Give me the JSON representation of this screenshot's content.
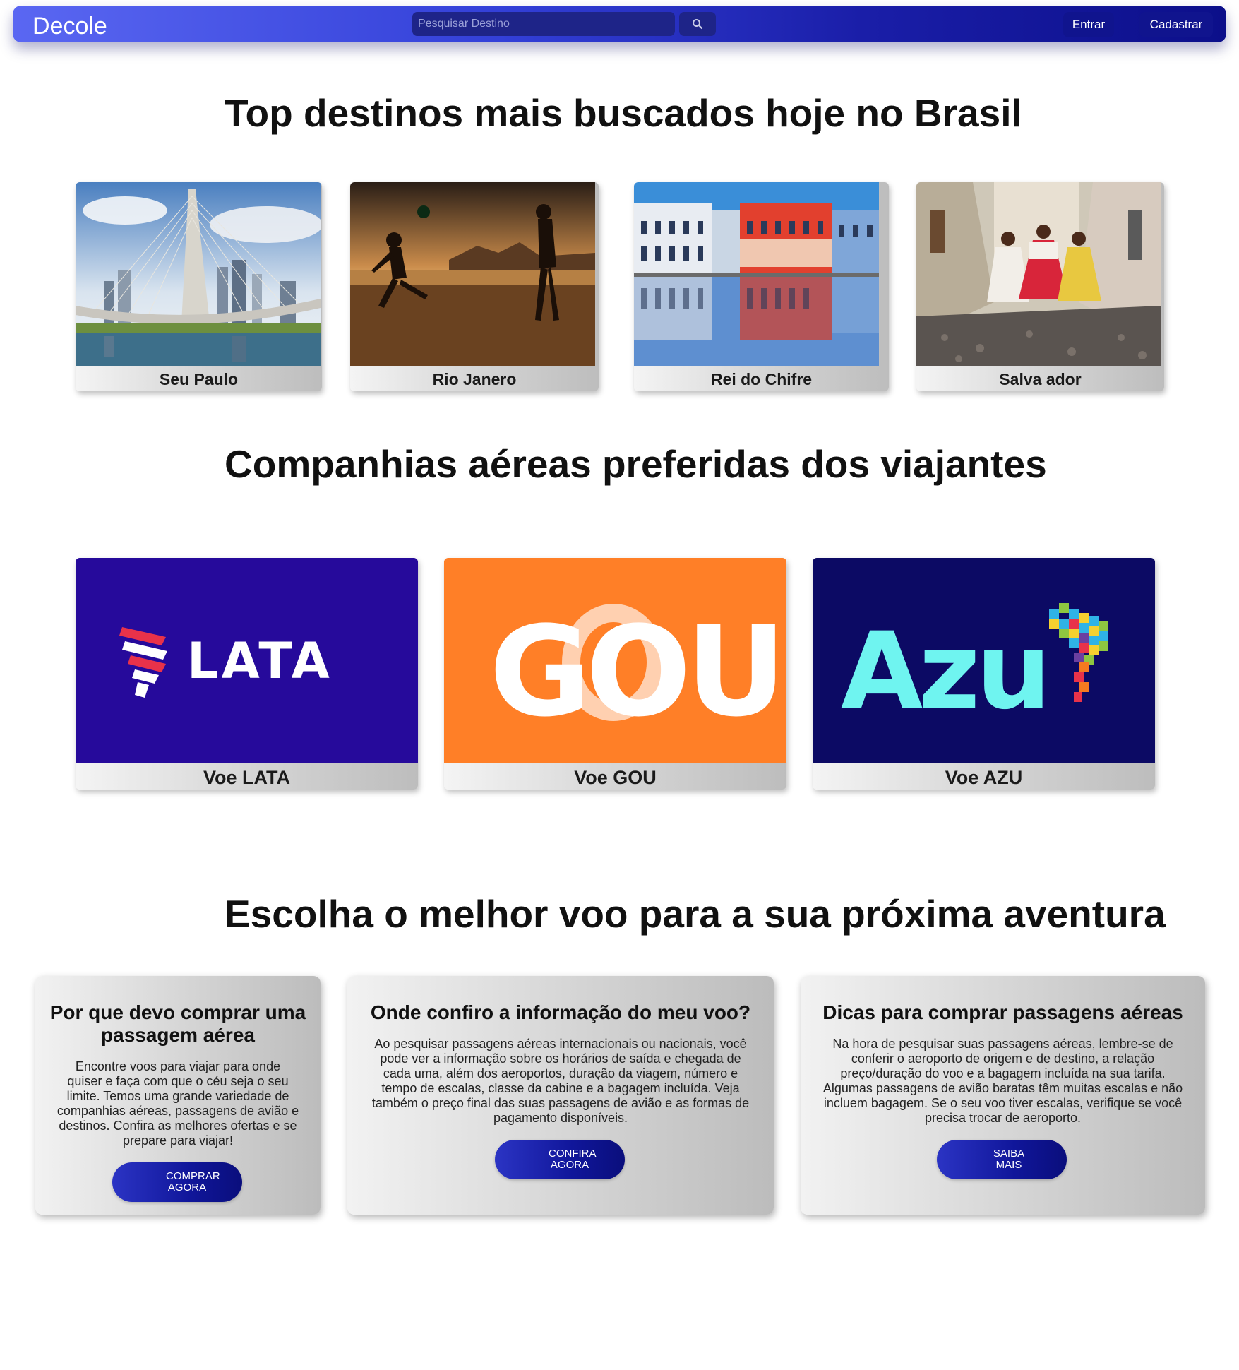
{
  "navbar": {
    "brand": "Decole",
    "search_placeholder": "Pesquisar Destino",
    "search_icon": "search-icon",
    "login_label": "Entrar",
    "signup_label": "Cadastrar"
  },
  "destinations": {
    "title": "Top destinos mais buscados hoje no Brasil",
    "items": [
      {
        "label": "Seu Paulo",
        "image": "cable-stayed-bridge-skyline"
      },
      {
        "label": "Rio Janero",
        "image": "beach-football-sunset"
      },
      {
        "label": "Rei do Chifre",
        "image": "colonial-buildings-reflection"
      },
      {
        "label": "Salva ador",
        "image": "cobblestone-street-baianas"
      }
    ]
  },
  "airlines": {
    "title": "Companhias aéreas preferidas dos viajantes",
    "items": [
      {
        "label": "Voe LATA",
        "logo_text": "LATA",
        "bg": "#260a9b",
        "fg": "#ffffff"
      },
      {
        "label": "Voe GOU",
        "logo_text": "GOU",
        "bg": "#ff7f27",
        "fg": "#ffffff"
      },
      {
        "label": "Voe AZU",
        "logo_text": "Azu",
        "bg": "#0c0a64",
        "fg": "#6ff4f0"
      }
    ]
  },
  "info": {
    "title": "Escolha o melhor voo para a sua próxima aventura",
    "cards": [
      {
        "title": "Por que devo comprar uma passagem aérea",
        "text": "Encontre voos para viajar para onde quiser e faça com que o céu seja o seu limite. Temos uma grande variedade de companhias aéreas, passagens de avião e destinos. Confira as melhores ofertas e se prepare para viajar!",
        "button": "COMPRAR AGORA"
      },
      {
        "title": "Onde confiro a informação do meu voo?",
        "text": "Ao pesquisar passagens aéreas internacionais ou nacionais, você pode ver a informação sobre os horários de saída e chegada de cada uma, além dos aeroportos, duração da viagem, número e tempo de escalas, classe da cabine e a bagagem incluída. Veja também o preço final das suas passagens de avião e as formas de pagamento disponíveis.",
        "button": "CONFIRA AGORA"
      },
      {
        "title": "Dicas para comprar passagens aéreas",
        "text": "Na hora de pesquisar suas passagens aéreas, lembre-se de conferir o aeroporto de origem e de destino, a relação preço/duração do voo e a bagagem incluída na sua tarifa. Algumas passagens de avião baratas têm muitas escalas e não incluem bagagem. Se o seu voo tiver escalas, verifique se você precisa trocar de aeroporto.",
        "button": "SAIBA MAIS"
      }
    ]
  },
  "colors": {
    "navbar_gradient_start": "#5a67f2",
    "navbar_gradient_end": "#0c0f8a",
    "button_blue": "#10169a"
  }
}
